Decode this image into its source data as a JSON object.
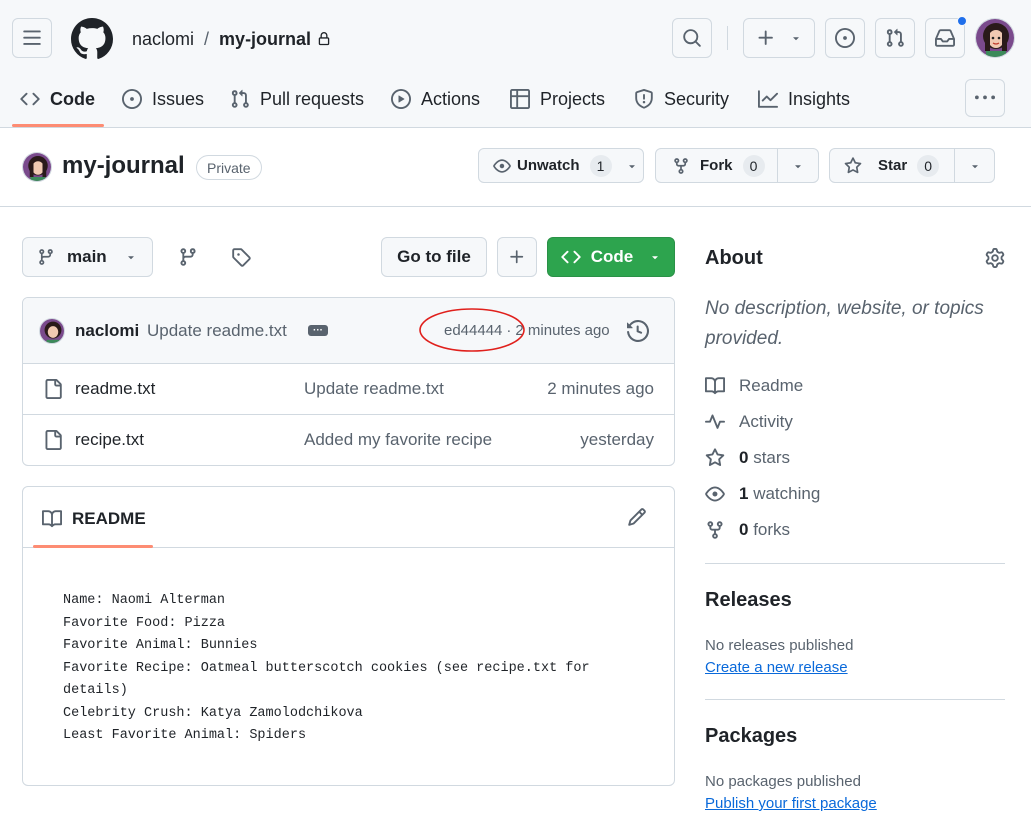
{
  "header": {
    "owner": "naclomi",
    "separator": "/",
    "repo": "my-journal"
  },
  "nav_tabs": [
    {
      "label": "Code",
      "icon": "code-icon",
      "selected": true
    },
    {
      "label": "Issues",
      "icon": "issue-icon"
    },
    {
      "label": "Pull requests",
      "icon": "pull-request-icon"
    },
    {
      "label": "Actions",
      "icon": "play-icon"
    },
    {
      "label": "Projects",
      "icon": "table-icon"
    },
    {
      "label": "Security",
      "icon": "shield-icon"
    },
    {
      "label": "Insights",
      "icon": "graph-icon"
    }
  ],
  "repo_header": {
    "name": "my-journal",
    "visibility": "Private",
    "unwatch_label": "Unwatch",
    "watch_count": "1",
    "fork_label": "Fork",
    "fork_count": "0",
    "star_label": "Star",
    "star_count": "0"
  },
  "toolbar": {
    "branch": "main",
    "go_to_file": "Go to file",
    "add": "+",
    "code": "Code"
  },
  "latest_commit": {
    "author": "naclomi",
    "message": "Update readme.txt",
    "sha": "ed44444",
    "dot": "·",
    "time": "2 minutes ago"
  },
  "files": [
    {
      "name": "readme.txt",
      "message": "Update readme.txt",
      "time": "2 minutes ago"
    },
    {
      "name": "recipe.txt",
      "message": "Added my favorite recipe",
      "time": "yesterday"
    }
  ],
  "readme": {
    "title": "README",
    "lines": [
      "Name: Naomi Alterman",
      "Favorite Food: Pizza",
      "Favorite Animal: Bunnies",
      "Favorite Recipe: Oatmeal butterscotch cookies (see recipe.txt for",
      "details)",
      "Celebrity Crush: Katya Zamolodchikova",
      "Least Favorite Animal: Spiders"
    ]
  },
  "about": {
    "title": "About",
    "description": "No description, website, or topics provided.",
    "readme": "Readme",
    "activity": "Activity",
    "stars_count": "0",
    "stars_label": "stars",
    "watching_count": "1",
    "watching_label": "watching",
    "forks_count": "0",
    "forks_label": "forks"
  },
  "releases": {
    "title": "Releases",
    "empty": "No releases published",
    "link": "Create a new release"
  },
  "packages": {
    "title": "Packages",
    "empty": "No packages published",
    "link": "Publish your first package"
  },
  "colors": {
    "accent_green": "#2da44e",
    "link_blue": "#0969da",
    "underline_orange": "#fd8c73",
    "annotation_red": "#e0201c",
    "notification_blue": "#1f6feb"
  }
}
